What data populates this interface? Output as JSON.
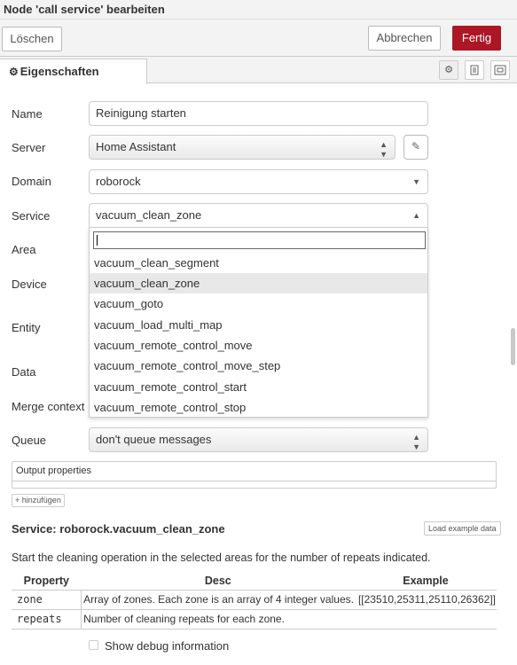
{
  "window": {
    "title": "Node 'call service' bearbeiten"
  },
  "toolbar": {
    "delete_label": "Löschen",
    "cancel_label": "Abbrechen",
    "done_label": "Fertig"
  },
  "tabs": {
    "properties_label": "Eigenschaften"
  },
  "form": {
    "name_label": "Name",
    "name_value": "Reinigung starten",
    "server_label": "Server",
    "server_value": "Home Assistant",
    "domain_label": "Domain",
    "domain_value": "roborock",
    "service_label": "Service",
    "service_value": "vacuum_clean_zone",
    "area_label": "Area",
    "device_label": "Device",
    "entity_label": "Entity",
    "data_label": "Data",
    "merge_label": "Merge context",
    "queue_label": "Queue",
    "queue_value": "don't queue messages"
  },
  "dropdown": {
    "search_value": "",
    "options": [
      "vacuum_clean_segment",
      "vacuum_clean_zone",
      "vacuum_goto",
      "vacuum_load_multi_map",
      "vacuum_remote_control_move",
      "vacuum_remote_control_move_step",
      "vacuum_remote_control_start",
      "vacuum_remote_control_stop"
    ],
    "highlighted": "vacuum_clean_zone"
  },
  "output": {
    "header": "Output properties",
    "add_label": "hinzufügen"
  },
  "service_info": {
    "title": "Service: roborock.vacuum_clean_zone",
    "load_example_label": "Load example data",
    "description": "Start the cleaning operation in the selected areas for the number of repeats indicated.",
    "columns": [
      "Property",
      "Desc",
      "Example"
    ],
    "rows": [
      {
        "property": "zone",
        "desc": "Array of zones. Each zone is an array of 4 integer values.",
        "example": "[[23510,25311,25110,26362]]"
      },
      {
        "property": "repeats",
        "desc": "Number of cleaning repeats for each zone.",
        "example": ""
      }
    ]
  },
  "debug": {
    "label": "Show debug information",
    "checked": false
  },
  "colors": {
    "primary": "#ad1625",
    "property_code": "#b5252a",
    "highlight": "#e8e8e8"
  },
  "icons": {
    "tab": "gear-icon",
    "edit": "pencil-icon",
    "description": "document-icon",
    "appearance": "frame-icon",
    "add": "plus-icon"
  }
}
